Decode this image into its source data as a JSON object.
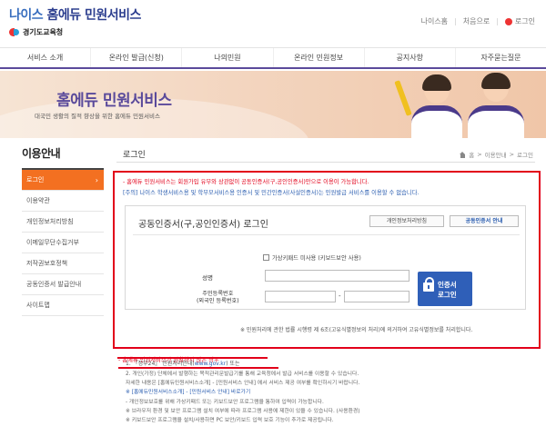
{
  "header": {
    "logo_text": "나이스 홈에듀 민원서비스",
    "logo_nice": "나이스",
    "logo_rest": " 홈에듀 민원서비스",
    "org": "경기도교육청",
    "links": [
      "나이스홈",
      "처음으로",
      "로그인"
    ]
  },
  "gnb": {
    "items": [
      "서비스 소개",
      "온라인 발급(신청)",
      "나의민원",
      "온라인 민원정보",
      "공지사항",
      "자주묻는질문"
    ]
  },
  "banner": {
    "title": "홈에듀 민원서비스",
    "subtitle": "대국민 생활의 질적 향상을 위한 홈에듀 민원서비스"
  },
  "lnb": {
    "title": "이용안내",
    "items": [
      "로그인",
      "이용약관",
      "개인정보처리방침",
      "이메일무단수집거부",
      "저작권보호정책",
      "공동인증서 발급안내",
      "사이트맵"
    ],
    "active_arrow": "›"
  },
  "content": {
    "title": "로그인",
    "breadcrumb": [
      "홈",
      "이용안내",
      "로그인"
    ],
    "breadcrumb_sep": ">",
    "notice_red": "- 홈에듀 민원서비스는 회원가입 유무와 상관없이 공동인증서(구,공인인증서)만으로 이용이 가능합니다.",
    "notice_blue": "[주의] 나이스 학생서비스용 및 학부모서비스용 인증서 및 민간인증서(사설인증서)는 민원발급 서비스를 이용할 수 없습니다."
  },
  "cert_panel": {
    "title": "공동인증서(구,공인인증서) 로그인",
    "btn_register": "개인정보처리방침",
    "btn_guide": "공동인증서 안내",
    "keyboard_label": "가상키패드 미사용 (키보드보안 사용)",
    "name_label": "성명",
    "rrn_label_1": "주민등록번호",
    "rrn_label_2": "(외국인 등록번호)",
    "rrn_dash": "-",
    "login_btn_1": "인증서",
    "login_btn_2": "로그인",
    "note": "※ 민원처리에 관한 법률 시행령 제 6조(고유식별정보의 처리)에 의거하여 고유식별정보를 처리합니다."
  },
  "help": {
    "head": "- 홈에듀 민원서비스가 원활하지 않은 경우",
    "line1_prefix": "1. 『정부24』 민원처리안내(",
    "line1_link": "www.gov.kr",
    "line1_suffix": ") 또는",
    "line2": "2. 개인(가정) 단체에서 발행하는 목적관리문발급기를 통해 교육청에서 발급 서비스를 이용할 수 있습니다.",
    "line3": "   자세한 내용은 [홈에듀민원서비스소개] - [민원서비스 안내] 에서 서비스 제공 여부를 확인하시기 바랍니다.",
    "line4": "   ※ [홈에듀민원서비스소개] - [민원서비스 안내] 바로가기",
    "line5": "- 개인정보보호를 위해 가상키패드 또는 키보드보안 프로그램을 통하여 입력이 가능합니다.",
    "line6": "  ※ 브라우저 환경 및 보안 프로그램 설치 여부에 따라 프로그램 사용에 제한이 있을 수 있습니다. (사용환경)",
    "line7": "  ※ 키보드보안 프로그램을 설치/사용하면 PC 보안/키보드 입력 보호 기능이 추가로 제공됩니다."
  }
}
